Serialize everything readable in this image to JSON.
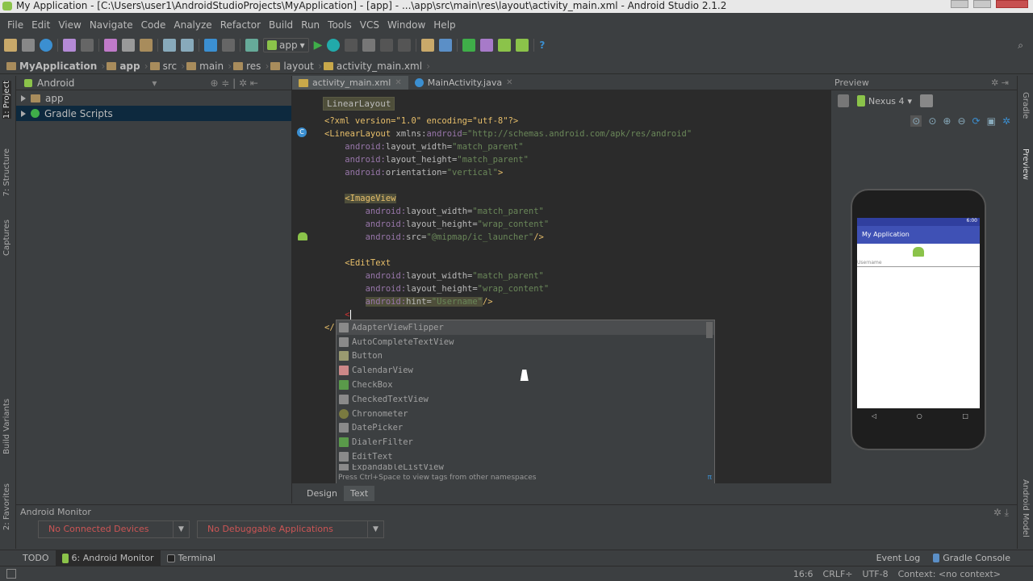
{
  "window": {
    "title": "My Application - [C:\\Users\\user1\\AndroidStudioProjects\\MyApplication] - [app] - ...\\app\\src\\main\\res\\layout\\activity_main.xml - Android Studio 2.1.2"
  },
  "menu": [
    "File",
    "Edit",
    "View",
    "Navigate",
    "Code",
    "Analyze",
    "Refactor",
    "Build",
    "Run",
    "Tools",
    "VCS",
    "Window",
    "Help"
  ],
  "toolbar": {
    "run_config": "app"
  },
  "breadcrumbs": [
    "MyApplication",
    "app",
    "src",
    "main",
    "res",
    "layout",
    "activity_main.xml"
  ],
  "project": {
    "view": "Android",
    "items": [
      {
        "label": "app"
      },
      {
        "label": "Gradle Scripts"
      }
    ]
  },
  "left_stripe": [
    "1: Project",
    "7: Structure",
    "Captures",
    "Build Variants",
    "2: Favorites"
  ],
  "right_stripe": [
    "Gradle",
    "Preview",
    "Android Model"
  ],
  "editor": {
    "tabs": [
      {
        "label": "activity_main.xml"
      },
      {
        "label": "MainActivity.java"
      }
    ],
    "tag_crumb": "LinearLayout",
    "code": {
      "l1": "<?xml version=\"1.0\" encoding=\"utf-8\"?>",
      "l2a": "<LinearLayout ",
      "l2b": "xmlns:",
      "l2c": "android",
      "l2d": "=\"http://schemas.android.com/apk/res/android\"",
      "a": "android:",
      "lw": "layout_width=",
      "lh": "layout_height=",
      "or": "orientation=",
      "src": "src=",
      "hint": "hint=",
      "mp": "\"match_parent\"",
      "wc": "\"wrap_content\"",
      "vert": "\"vertical\"",
      "gt": ">",
      "close": "/>",
      "iv": "<ImageView",
      "et": "<EditText",
      "srcv": "\"@mipmap/ic_launcher\"",
      "hintv": "\"Username\"",
      "lt": "<",
      "endlt": "</"
    },
    "completion": {
      "items": [
        "AdapterViewFlipper",
        "AutoCompleteTextView",
        "Button",
        "CalendarView",
        "CheckBox",
        "CheckedTextView",
        "Chronometer",
        "DatePicker",
        "DialerFilter",
        "EditText",
        "ExpandableListView"
      ],
      "footer": "Press Ctrl+Space to view tags from other namespaces",
      "pi": "π"
    },
    "bottom_tabs": [
      "Design",
      "Text"
    ]
  },
  "preview": {
    "title": "Preview",
    "device": "Nexus 4",
    "app_title": "My Application",
    "status_time": "6:00",
    "hint": "Username"
  },
  "monitor": {
    "title": "Android Monitor",
    "devices": "No Connected Devices",
    "apps": "No Debuggable Applications"
  },
  "tool_windows": {
    "todo": "TODO",
    "monitor": "6: Android Monitor",
    "terminal": "Terminal",
    "event_log": "Event Log",
    "gradle_console": "Gradle Console"
  },
  "status": {
    "position": "16:6",
    "line_sep": "CRLF÷",
    "encoding": "UTF-8",
    "context": "Context: <no context>"
  }
}
